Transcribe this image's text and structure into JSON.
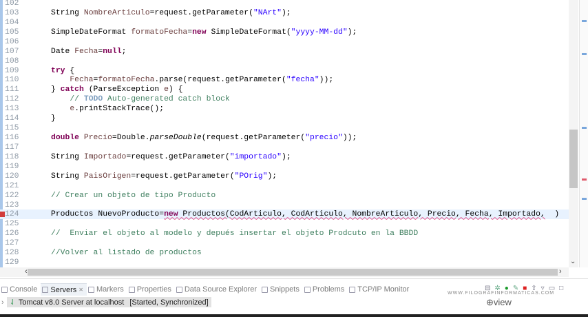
{
  "editor": {
    "lines": [
      {
        "n": "102",
        "segs": []
      },
      {
        "n": "103",
        "segs": [
          [
            "pl",
            "String "
          ],
          [
            "var",
            "NombreArticulo"
          ],
          [
            "pl",
            "=request.getParameter("
          ],
          [
            "str",
            "\"NArt\""
          ],
          [
            "pl",
            ");"
          ]
        ]
      },
      {
        "n": "104",
        "segs": []
      },
      {
        "n": "105",
        "segs": [
          [
            "pl",
            "SimpleDateFormat "
          ],
          [
            "var",
            "formatoFecha"
          ],
          [
            "pl",
            "="
          ],
          [
            "kw",
            "new"
          ],
          [
            "pl",
            " SimpleDateFormat("
          ],
          [
            "str",
            "\"yyyy-MM-dd\""
          ],
          [
            "pl",
            ");"
          ]
        ]
      },
      {
        "n": "106",
        "segs": []
      },
      {
        "n": "107",
        "segs": [
          [
            "pl",
            "Date "
          ],
          [
            "var",
            "Fecha"
          ],
          [
            "pl",
            "="
          ],
          [
            "kw",
            "null"
          ],
          [
            "pl",
            ";"
          ]
        ]
      },
      {
        "n": "108",
        "segs": []
      },
      {
        "n": "109",
        "segs": [
          [
            "kw",
            "try"
          ],
          [
            "pl",
            " {"
          ]
        ]
      },
      {
        "n": "110",
        "segs": [
          [
            "pl",
            "    "
          ],
          [
            "var",
            "Fecha"
          ],
          [
            "pl",
            "="
          ],
          [
            "var",
            "formatoFecha"
          ],
          [
            "pl",
            ".parse(request.getParameter("
          ],
          [
            "str",
            "\"fecha\""
          ],
          [
            "pl",
            "));"
          ]
        ]
      },
      {
        "n": "111",
        "segs": [
          [
            "pl",
            "} "
          ],
          [
            "kw",
            "catch"
          ],
          [
            "pl",
            " (ParseException "
          ],
          [
            "var",
            "e"
          ],
          [
            "pl",
            ") {"
          ]
        ]
      },
      {
        "n": "112",
        "segs": [
          [
            "cm",
            "    // "
          ],
          [
            "todo",
            "TODO"
          ],
          [
            "cm",
            " Auto-generated catch block"
          ]
        ]
      },
      {
        "n": "113",
        "segs": [
          [
            "pl",
            "    "
          ],
          [
            "var",
            "e"
          ],
          [
            "pl",
            ".printStackTrace();"
          ]
        ]
      },
      {
        "n": "114",
        "segs": [
          [
            "pl",
            "}"
          ]
        ]
      },
      {
        "n": "115",
        "segs": []
      },
      {
        "n": "116",
        "segs": [
          [
            "kw",
            "double"
          ],
          [
            "pl",
            " "
          ],
          [
            "var",
            "Precio"
          ],
          [
            "pl",
            "=Double."
          ],
          [
            "it",
            "parseDouble"
          ],
          [
            "pl",
            "(request.getParameter("
          ],
          [
            "str",
            "\"precio\""
          ],
          [
            "pl",
            "));"
          ]
        ]
      },
      {
        "n": "117",
        "segs": []
      },
      {
        "n": "118",
        "segs": [
          [
            "pl",
            "String "
          ],
          [
            "var",
            "Importado"
          ],
          [
            "pl",
            "=request.getParameter("
          ],
          [
            "str",
            "\"importado\""
          ],
          [
            "pl",
            ");"
          ]
        ]
      },
      {
        "n": "119",
        "segs": []
      },
      {
        "n": "120",
        "segs": [
          [
            "pl",
            "String "
          ],
          [
            "var",
            "PaisOrigen"
          ],
          [
            "pl",
            "=request.getParameter("
          ],
          [
            "str",
            "\"POrig\""
          ],
          [
            "pl",
            ");"
          ]
        ]
      },
      {
        "n": "121",
        "segs": []
      },
      {
        "n": "122",
        "segs": [
          [
            "cm",
            "// Crear un objeto de tipo Producto"
          ]
        ]
      },
      {
        "n": "123",
        "segs": []
      },
      {
        "n": "124",
        "current": true,
        "error": true,
        "segs": [
          [
            "pl",
            "Productos NuevoProducto="
          ],
          [
            "kw err",
            "new"
          ],
          [
            "pl err",
            " Productos(CodArticulo, CodArticulo, NombreArticulo, Precio, Fecha, Importado,"
          ],
          [
            "pl",
            "  )"
          ]
        ]
      },
      {
        "n": "125",
        "segs": []
      },
      {
        "n": "126",
        "segs": [
          [
            "cm",
            "//  Enviar el objeto al modelo y depués insertar el objeto Prodcuto en la BBDD"
          ]
        ]
      },
      {
        "n": "127",
        "segs": []
      },
      {
        "n": "128",
        "segs": [
          [
            "cm",
            "//Volver al listado de productos"
          ]
        ]
      },
      {
        "n": "129",
        "segs": []
      }
    ]
  },
  "panel": {
    "tabs": [
      {
        "label": "Console",
        "icon": "console-icon"
      },
      {
        "label": "Servers",
        "icon": "servers-icon",
        "active": true,
        "close": "✕"
      },
      {
        "label": "Markers",
        "icon": "markers-icon"
      },
      {
        "label": "Properties",
        "icon": "properties-icon"
      },
      {
        "label": "Data Source Explorer",
        "icon": "data-source-icon"
      },
      {
        "label": "Snippets",
        "icon": "snippets-icon"
      },
      {
        "label": "Problems",
        "icon": "problems-icon"
      },
      {
        "label": "TCP/IP Monitor",
        "icon": "tcpip-monitor-icon"
      }
    ],
    "server_name": "Tomcat v8.0 Server at localhost",
    "server_status": "[Started, Synchronized]",
    "expand_glyph": "›"
  },
  "watermark": {
    "site": "WWW.FILOGRAFINFORMATICAS.COM",
    "logo": "view"
  },
  "colors": {
    "keyword": "#7f0055",
    "string": "#2a00ff",
    "comment": "#3f7f5f",
    "variable": "#6a3e3e",
    "current_line": "#e8f2fe"
  }
}
